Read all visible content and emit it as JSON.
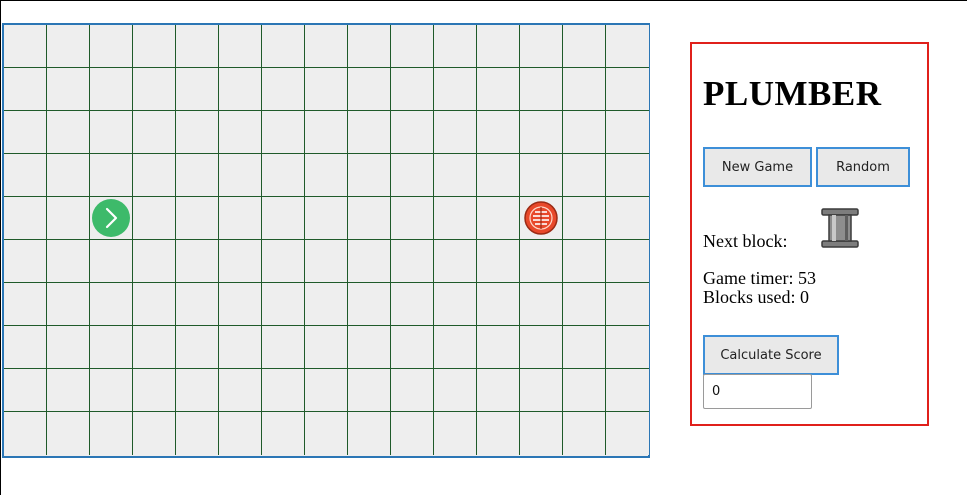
{
  "board": {
    "columns": 15,
    "rows": 10,
    "cell_color": "#eeeeee",
    "grid_line_color": "#1f5a2a",
    "border_color": "#2b76b5",
    "pieces": [
      {
        "name": "start-pipe-icon",
        "row": 4,
        "col": 2,
        "kind": "start",
        "color": "#3dba6a"
      },
      {
        "name": "end-drain-icon",
        "row": 4,
        "col": 12,
        "kind": "end",
        "color": "#e8482a"
      }
    ]
  },
  "panel": {
    "title": "PLUMBER",
    "new_game_label": "New Game",
    "random_label": "Random",
    "next_block_label": "Next block:",
    "next_block_icon": "vertical-pipe-icon",
    "timer_text": "Game timer: 53",
    "blocks_text": "Blocks used: 0",
    "calc_label": "Calculate Score",
    "score_value": "0",
    "border_color": "#e0201b",
    "button_border_color": "#3d8fd8"
  }
}
